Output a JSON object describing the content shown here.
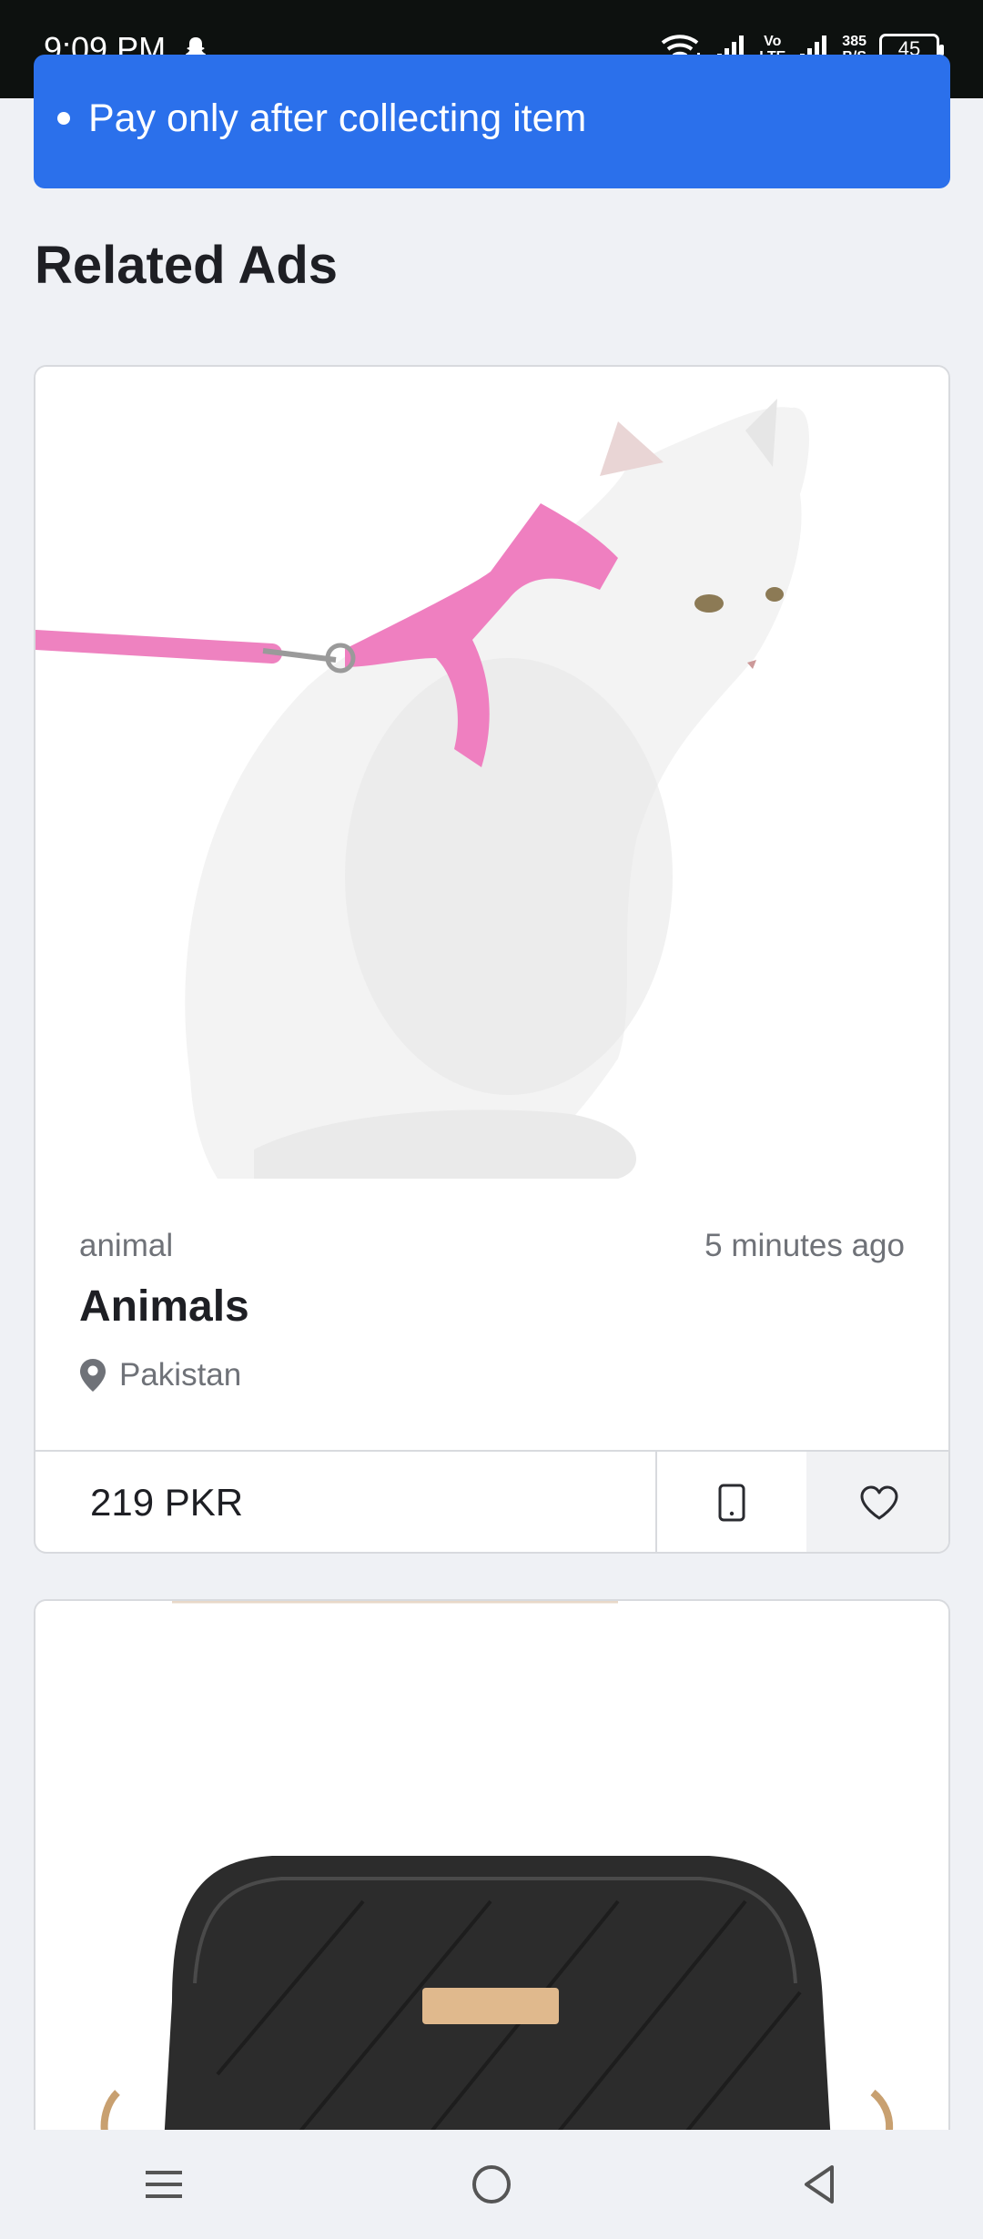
{
  "status_bar": {
    "time": "9:09 PM",
    "network_top": "Vo",
    "network_bottom": "LTE",
    "speed_value": "385",
    "speed_unit": "B/S",
    "battery": "45"
  },
  "info_banner": {
    "items": [
      "Pay only after collecting item"
    ],
    "color": "#2b70eb"
  },
  "related": {
    "title": "Related Ads"
  },
  "ads": [
    {
      "category": "animal",
      "time": "5 minutes ago",
      "title": "Animals",
      "location": "Pakistan",
      "price": "219 PKR",
      "image": "white-cat-with-pink-harness",
      "icons": [
        "map-pin-icon",
        "phone-icon",
        "heart-icon"
      ]
    },
    {
      "image": "black-quilted-crossbody-bag"
    }
  ],
  "nav": {
    "icons": [
      "menu-icon",
      "home-icon",
      "back-icon"
    ]
  }
}
